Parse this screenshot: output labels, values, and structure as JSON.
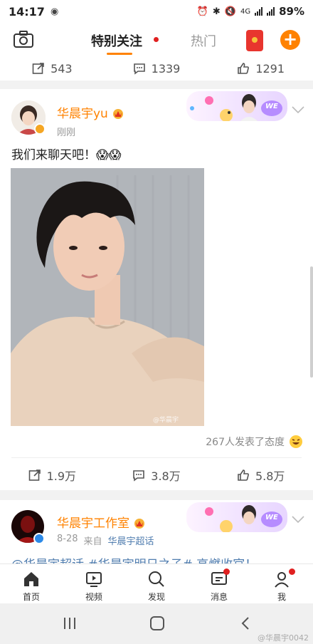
{
  "status": {
    "time": "14:17",
    "network": "4G",
    "battery": "89%"
  },
  "topnav": {
    "tab_special": "特别关注",
    "tab_hot": "热门"
  },
  "prev_post": {
    "repost": "543",
    "comment": "1339",
    "like": "1291"
  },
  "post1": {
    "username": "华晨宇yu",
    "time": "刚刚",
    "text": "我们来聊天吧！😱😱",
    "image_watermark": "@华晨宇",
    "attitude": "267人发表了态度",
    "repost": "1.9万",
    "comment": "3.8万",
    "like": "5.8万"
  },
  "post2": {
    "username": "华晨宇工作室",
    "date": "8-28",
    "from_label": "来自",
    "source": "华晨宇超话",
    "text_partial": "@华晨宇超话 #华晨宇明日之子# 高燃收官！"
  },
  "banner": {
    "text": "WE"
  },
  "bottomnav": [
    {
      "label": "首页",
      "icon": "home-icon"
    },
    {
      "label": "视频",
      "icon": "video-icon"
    },
    {
      "label": "发现",
      "icon": "discover-icon"
    },
    {
      "label": "消息",
      "icon": "message-icon"
    },
    {
      "label": "我",
      "icon": "profile-icon"
    }
  ],
  "watermark": "@华晨宇0042",
  "colors": {
    "accent": "#ff8200",
    "red": "#e02020",
    "link": "#507daf"
  }
}
